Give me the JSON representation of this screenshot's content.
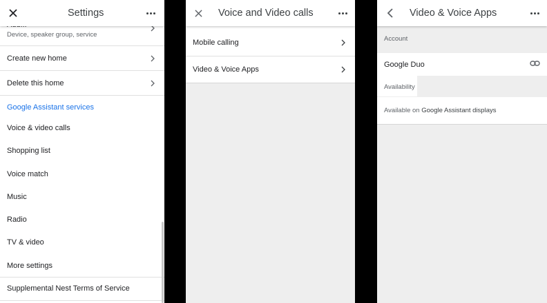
{
  "panel1": {
    "title": "Settings",
    "truncated_title": "Add...",
    "truncated_subtitle": "Device, speaker group, service",
    "rows": [
      {
        "label": "Create new home"
      },
      {
        "label": "Delete this home"
      }
    ],
    "section_header": "Google Assistant services",
    "services": [
      "Voice & video calls",
      "Shopping list",
      "Voice match",
      "Music",
      "Radio",
      "TV & video",
      "More settings",
      "Supplemental Nest Terms of Service"
    ]
  },
  "panel2": {
    "title": "Voice and Video calls",
    "items": [
      {
        "label": "Mobile calling"
      },
      {
        "label": "Video & Voice Apps"
      }
    ]
  },
  "panel3": {
    "title": "Video & Voice Apps",
    "account_label": "Account",
    "account_value": "Google Duo",
    "availability_label": "Availability",
    "availability_prefix": "Available on ",
    "availability_value": "Google Assistant displays"
  },
  "icons": {
    "close": "close-icon",
    "more": "more-vert-icon",
    "chevron": "chevron-right-icon",
    "back": "back-arrow-icon",
    "link": "link-icon"
  },
  "colors": {
    "accent": "#1a73e8",
    "background": "#eeeeee",
    "divider_bars": "#000000"
  }
}
